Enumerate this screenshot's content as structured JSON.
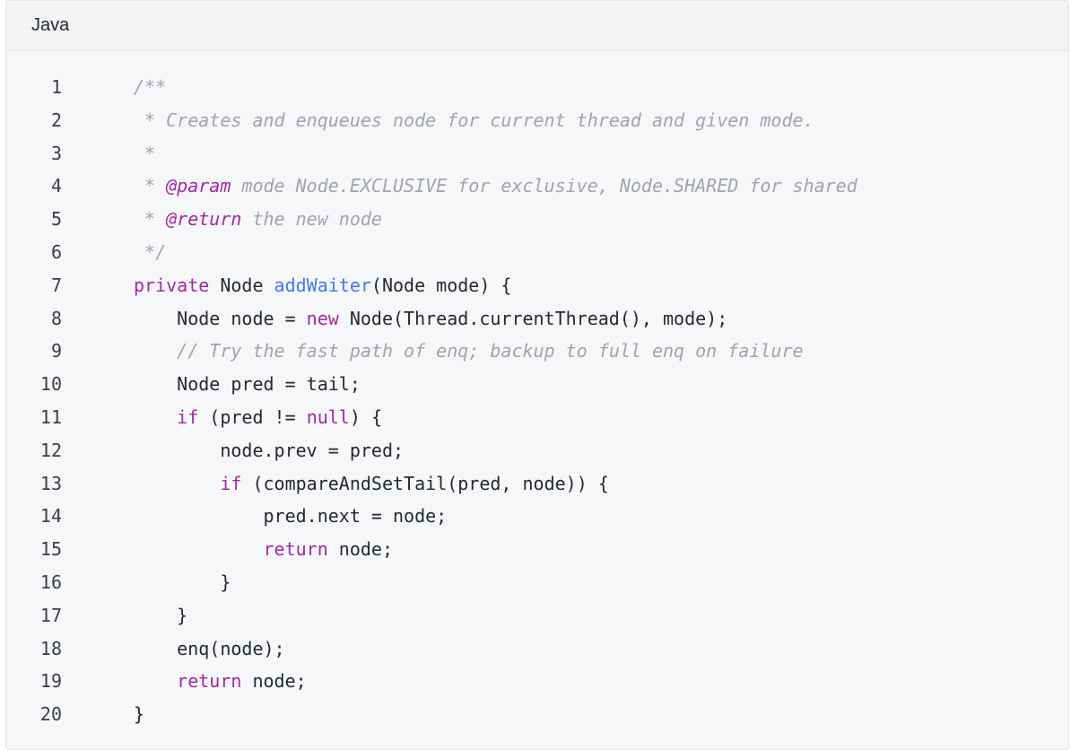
{
  "header": {
    "language": "Java"
  },
  "colors": {
    "comment": "#a0a4aa",
    "keyword": "#a626a4",
    "function": "#4078f2",
    "text": "#24292f"
  },
  "lines": [
    {
      "n": "1",
      "tokens": [
        {
          "t": "c",
          "v": "/**"
        }
      ]
    },
    {
      "n": "2",
      "tokens": [
        {
          "t": "c",
          "v": " * Creates and enqueues node for current thread and given mode."
        }
      ]
    },
    {
      "n": "3",
      "tokens": [
        {
          "t": "c",
          "v": " *"
        }
      ]
    },
    {
      "n": "4",
      "tokens": [
        {
          "t": "c",
          "v": " * "
        },
        {
          "t": "d",
          "v": "@param"
        },
        {
          "t": "c",
          "v": " mode Node.EXCLUSIVE for exclusive, Node.SHARED for shared"
        }
      ]
    },
    {
      "n": "5",
      "tokens": [
        {
          "t": "c",
          "v": " * "
        },
        {
          "t": "d",
          "v": "@return"
        },
        {
          "t": "c",
          "v": " the new node"
        }
      ]
    },
    {
      "n": "6",
      "tokens": [
        {
          "t": "c",
          "v": " */"
        }
      ]
    },
    {
      "n": "7",
      "tokens": [
        {
          "t": "k",
          "v": "private"
        },
        {
          "t": "p",
          "v": " Node "
        },
        {
          "t": "f",
          "v": "addWaiter"
        },
        {
          "t": "p",
          "v": "(Node mode) {"
        }
      ]
    },
    {
      "n": "8",
      "tokens": [
        {
          "t": "p",
          "v": "    Node node = "
        },
        {
          "t": "k",
          "v": "new"
        },
        {
          "t": "p",
          "v": " Node(Thread.currentThread(), mode);"
        }
      ]
    },
    {
      "n": "9",
      "tokens": [
        {
          "t": "p",
          "v": "    "
        },
        {
          "t": "c",
          "v": "// Try the fast path of enq; backup to full enq on failure"
        }
      ]
    },
    {
      "n": "10",
      "tokens": [
        {
          "t": "p",
          "v": "    Node pred = tail;"
        }
      ]
    },
    {
      "n": "11",
      "tokens": [
        {
          "t": "p",
          "v": "    "
        },
        {
          "t": "k",
          "v": "if"
        },
        {
          "t": "p",
          "v": " (pred != "
        },
        {
          "t": "k",
          "v": "null"
        },
        {
          "t": "p",
          "v": ") {"
        }
      ]
    },
    {
      "n": "12",
      "tokens": [
        {
          "t": "p",
          "v": "        node.prev = pred;"
        }
      ]
    },
    {
      "n": "13",
      "tokens": [
        {
          "t": "p",
          "v": "        "
        },
        {
          "t": "k",
          "v": "if"
        },
        {
          "t": "p",
          "v": " (compareAndSetTail(pred, node)) {"
        }
      ]
    },
    {
      "n": "14",
      "tokens": [
        {
          "t": "p",
          "v": "            pred.next = node;"
        }
      ]
    },
    {
      "n": "15",
      "tokens": [
        {
          "t": "p",
          "v": "            "
        },
        {
          "t": "k",
          "v": "return"
        },
        {
          "t": "p",
          "v": " node;"
        }
      ]
    },
    {
      "n": "16",
      "tokens": [
        {
          "t": "p",
          "v": "        }"
        }
      ]
    },
    {
      "n": "17",
      "tokens": [
        {
          "t": "p",
          "v": "    }"
        }
      ]
    },
    {
      "n": "18",
      "tokens": [
        {
          "t": "p",
          "v": "    enq(node);"
        }
      ]
    },
    {
      "n": "19",
      "tokens": [
        {
          "t": "p",
          "v": "    "
        },
        {
          "t": "k",
          "v": "return"
        },
        {
          "t": "p",
          "v": " node;"
        }
      ]
    },
    {
      "n": "20",
      "tokens": [
        {
          "t": "p",
          "v": "}"
        }
      ]
    }
  ]
}
